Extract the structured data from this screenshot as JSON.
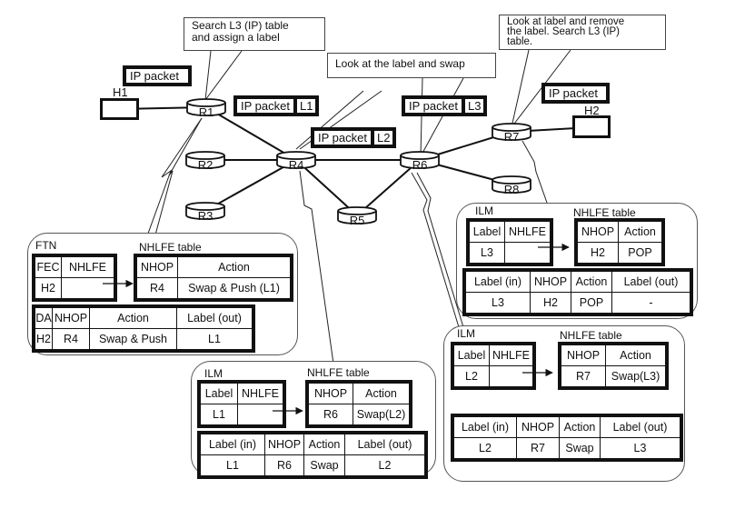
{
  "hosts": [
    {
      "id": "H1",
      "label": "H1"
    },
    {
      "id": "H2",
      "label": "H2"
    }
  ],
  "routers": [
    {
      "id": "R1",
      "label": "R1"
    },
    {
      "id": "R2",
      "label": "R2"
    },
    {
      "id": "R3",
      "label": "R3"
    },
    {
      "id": "R4",
      "label": "R4"
    },
    {
      "id": "R5",
      "label": "R5"
    },
    {
      "id": "R6",
      "label": "R6"
    },
    {
      "id": "R7",
      "label": "R7"
    },
    {
      "id": "R8",
      "label": "R8"
    }
  ],
  "links": [
    [
      "H1",
      "R1"
    ],
    [
      "R1",
      "R4"
    ],
    [
      "R2",
      "R4"
    ],
    [
      "R3",
      "R4"
    ],
    [
      "R4",
      "R6"
    ],
    [
      "R4",
      "R5"
    ],
    [
      "R5",
      "R6"
    ],
    [
      "R6",
      "R7"
    ],
    [
      "R6",
      "R8"
    ],
    [
      "R7",
      "H2"
    ]
  ],
  "callouts": {
    "r1": "Search L3 (IP) table\nand assign a label",
    "r4r6": "Look at the label and swap",
    "r7": "Look at label and remove\nthe label. Search L3 (IP)\ntable."
  },
  "packets": {
    "p1": {
      "payload": "IP packet"
    },
    "p2": {
      "payload": "IP packet",
      "label": "L1"
    },
    "p3": {
      "payload": "IP packet",
      "label": "L2"
    },
    "p4": {
      "payload": "IP packet",
      "label": "L3"
    },
    "p5": {
      "payload": "IP packet"
    }
  },
  "panels": {
    "r1": {
      "title": "FTN",
      "nhlfe_title": "NHLFE table",
      "map_headers": [
        "FEC",
        "NHLFE"
      ],
      "map_row": [
        "H2",
        ""
      ],
      "nhlfe_headers": [
        "NHOP",
        "Action"
      ],
      "nhlfe_row": [
        "R4",
        "Swap & Push (L1)"
      ],
      "combined_headers": [
        "DA",
        "NHOP",
        "Action",
        "Label (out)"
      ],
      "combined_row": [
        "H2",
        "R4",
        "Swap & Push",
        "L1"
      ]
    },
    "r4": {
      "title": "ILM",
      "nhlfe_title": "NHLFE table",
      "map_headers": [
        "Label",
        "NHLFE"
      ],
      "map_row": [
        "L1",
        ""
      ],
      "nhlfe_headers": [
        "NHOP",
        "Action"
      ],
      "nhlfe_row": [
        "R6",
        "Swap(L2)"
      ],
      "combined_headers": [
        "Label (in)",
        "NHOP",
        "Action",
        "Label (out)"
      ],
      "combined_row": [
        "L1",
        "R6",
        "Swap",
        "L2"
      ]
    },
    "r6": {
      "title": "ILM",
      "nhlfe_title": "NHLFE table",
      "map_headers": [
        "Label",
        "NHLFE"
      ],
      "map_row": [
        "L2",
        ""
      ],
      "nhlfe_headers": [
        "NHOP",
        "Action"
      ],
      "nhlfe_row": [
        "R7",
        "Swap(L3)"
      ],
      "combined_headers": [
        "Label (in)",
        "NHOP",
        "Action",
        "Label (out)"
      ],
      "combined_row": [
        "L2",
        "R7",
        "Swap",
        "L3"
      ]
    },
    "r7": {
      "title": "ILM",
      "nhlfe_title": "NHLFE table",
      "map_headers": [
        "Label",
        "NHLFE"
      ],
      "map_row": [
        "L3",
        ""
      ],
      "nhlfe_headers": [
        "NHOP",
        "Action"
      ],
      "nhlfe_row": [
        "H2",
        "POP"
      ],
      "combined_headers": [
        "Label (in)",
        "NHOP",
        "Action",
        "Label (out)"
      ],
      "combined_row": [
        "L3",
        "H2",
        "POP",
        "-"
      ]
    }
  }
}
